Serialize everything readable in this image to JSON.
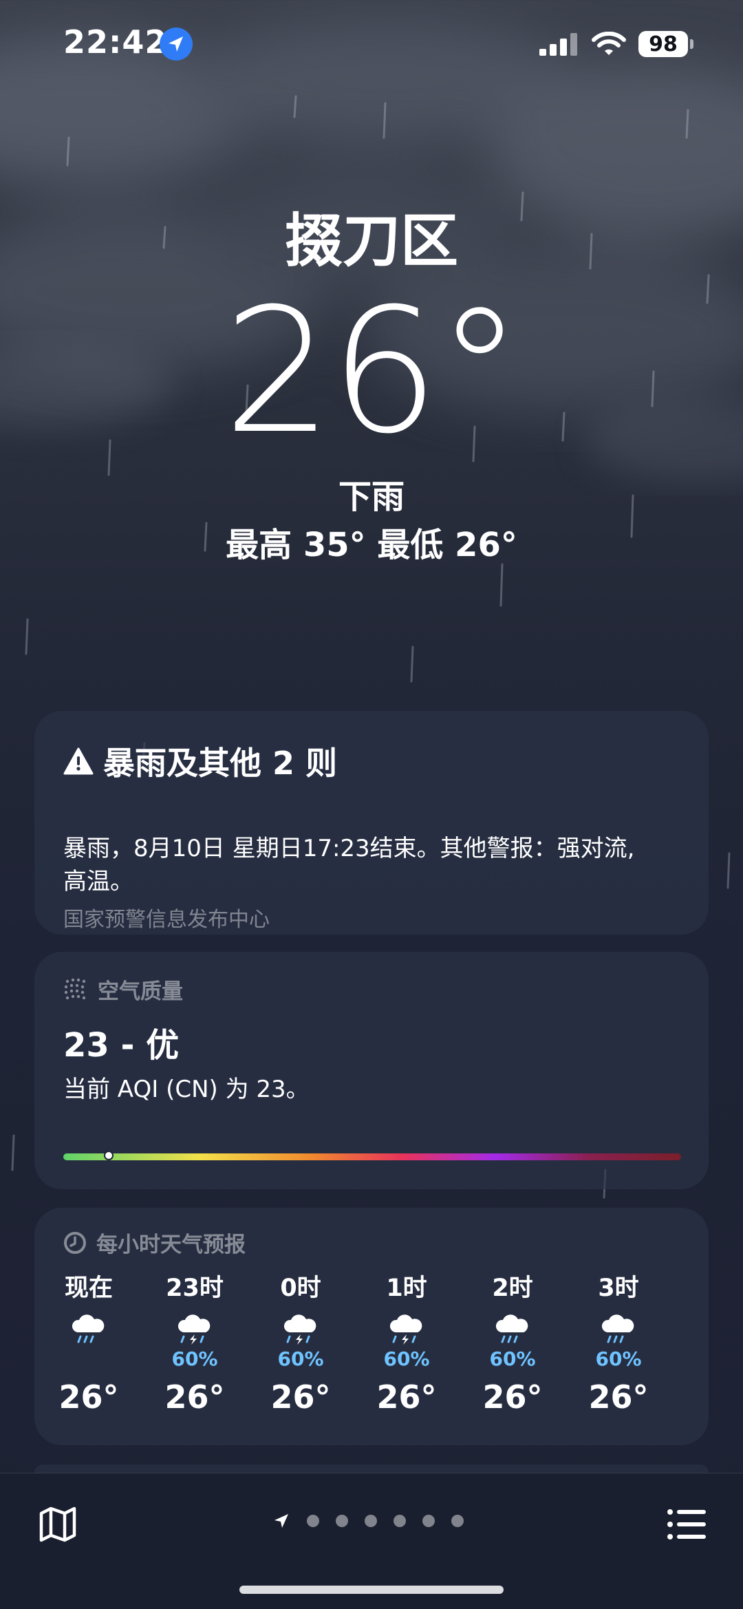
{
  "status_bar": {
    "time": "22:42",
    "battery": "98",
    "location_icon": "location-arrow-icon",
    "signal_icon": "cellular-signal-icon",
    "wifi_icon": "wifi-icon"
  },
  "hero": {
    "city": "掇刀区",
    "temperature": "26°",
    "condition": "下雨",
    "high_low": "最高 35°  最低 26°"
  },
  "alert": {
    "icon": "warning-triangle-icon",
    "title": "暴雨及其他 2 则",
    "body": "暴雨，8月10日 星期日17:23结束。其他警报：强对流, 高温。",
    "source": "国家预警信息发布中心"
  },
  "air_quality": {
    "icon": "air-particles-icon",
    "header": "空气质量",
    "value": "23 - 优",
    "description": "当前 AQI (CN) 为 23。",
    "aqi": 23,
    "scale_max": 500
  },
  "hourly": {
    "icon": "clock-icon",
    "header": "每小时天气预报",
    "items": [
      {
        "label": "现在",
        "icon": "cloud-rain-icon",
        "precip": "",
        "temp": "26°"
      },
      {
        "label": "23时",
        "icon": "cloud-thunderstorm-icon",
        "precip": "60%",
        "temp": "26°"
      },
      {
        "label": "0时",
        "icon": "cloud-thunderstorm-icon",
        "precip": "60%",
        "temp": "26°"
      },
      {
        "label": "1时",
        "icon": "cloud-thunderstorm-icon",
        "precip": "60%",
        "temp": "26°"
      },
      {
        "label": "2时",
        "icon": "cloud-rain-icon",
        "precip": "60%",
        "temp": "26°"
      },
      {
        "label": "3时",
        "icon": "cloud-rain-icon",
        "precip": "60%",
        "temp": "26°"
      }
    ]
  },
  "bottom_bar": {
    "map_icon": "map-icon",
    "list_icon": "list-icon",
    "page_count": 7,
    "current_page": 0
  },
  "colors": {
    "precip": "#6fc3ff",
    "location_badge": "#2f7cf6",
    "background_top": "#3b404c",
    "background_bottom": "#1d2233"
  }
}
